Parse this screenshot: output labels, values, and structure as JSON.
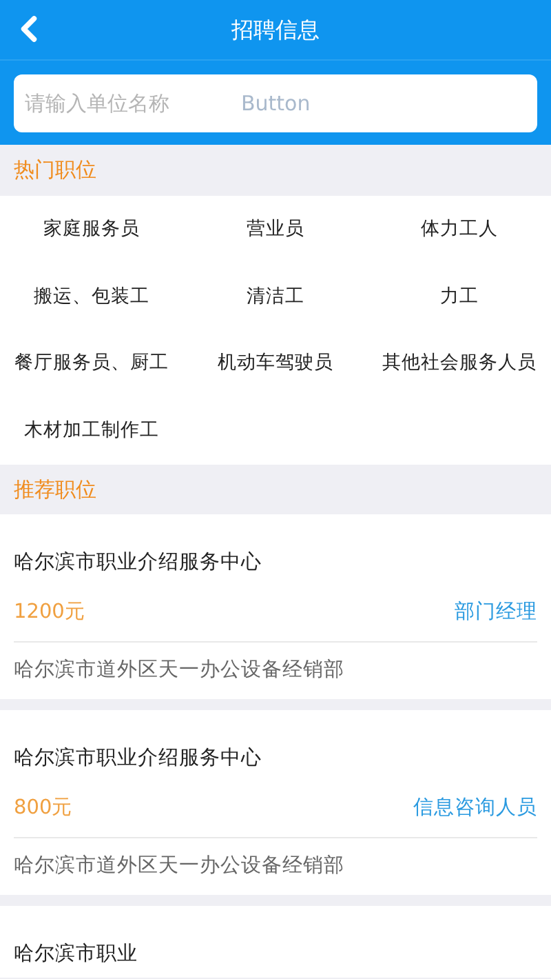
{
  "header": {
    "title": "招聘信息"
  },
  "search": {
    "placeholder": "请输入单位名称",
    "button": "Button"
  },
  "hot_section": {
    "title": "热门职位",
    "items": [
      "家庭服务员",
      "营业员",
      "体力工人",
      "搬运、包装工",
      "清洁工",
      "力工",
      "餐厅服务员、厨工",
      "机动车驾驶员",
      "其他社会服务人员",
      "木材加工制作工"
    ]
  },
  "recommend_section": {
    "title": "推荐职位",
    "jobs": [
      {
        "company": "哈尔滨市职业介绍服务中心",
        "salary": "1200元",
        "position": "部门经理",
        "address": "哈尔滨市道外区天一办公设备经销部"
      },
      {
        "company": "哈尔滨市职业介绍服务中心",
        "salary": "800元",
        "position": "信息咨询人员",
        "address": "哈尔滨市道外区天一办公设备经销部"
      },
      {
        "company": "哈尔滨市职业"
      }
    ]
  }
}
